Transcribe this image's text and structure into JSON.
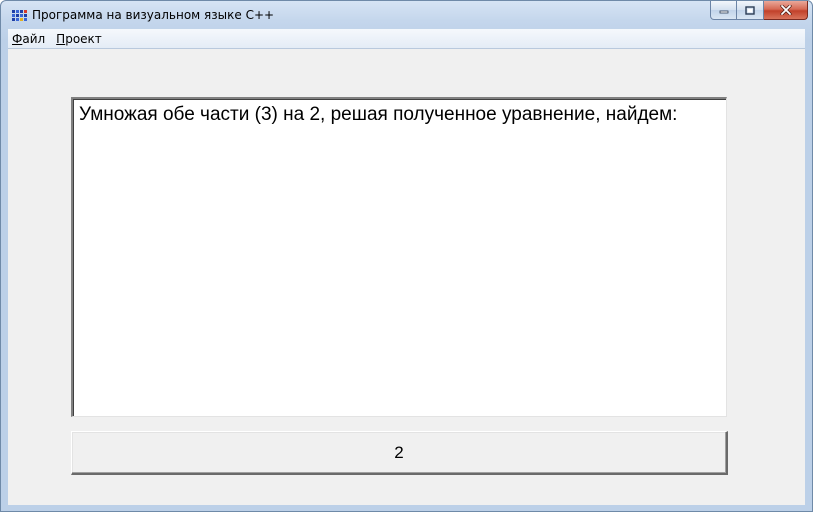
{
  "window": {
    "title": "Программа на визуальном языке С++",
    "app_icon": "app-grid-icon",
    "caption_buttons": [
      "minimize-icon",
      "maximize-icon",
      "close-icon"
    ]
  },
  "menu": {
    "items": [
      {
        "hotkey": "Ф",
        "rest": "айл"
      },
      {
        "hotkey": "П",
        "rest": "роект"
      }
    ]
  },
  "content": {
    "text": "Умножая обе части (3) на 2, решая полученное уравнение, найдем:",
    "button_label": "2"
  },
  "colors": {
    "titlebar": "#c4d6ec",
    "client": "#f0f0f0",
    "close_button": "#c1412a"
  }
}
